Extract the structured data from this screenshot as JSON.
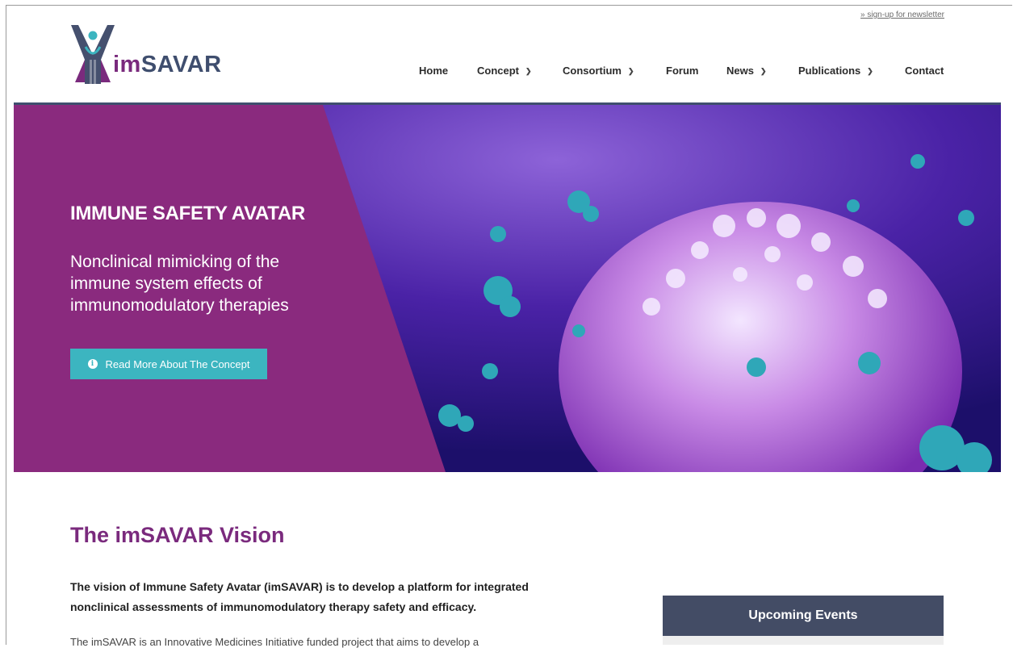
{
  "header": {
    "newsletter_link": "» sign-up for newsletter",
    "logo_text_im": "im",
    "logo_text_savar": "SAVAR"
  },
  "nav": {
    "items": [
      {
        "label": "Home",
        "has_dropdown": false
      },
      {
        "label": "Concept",
        "has_dropdown": true
      },
      {
        "label": "Consortium",
        "has_dropdown": true
      },
      {
        "label": "Forum",
        "has_dropdown": false
      },
      {
        "label": "News",
        "has_dropdown": true
      },
      {
        "label": "Publications",
        "has_dropdown": true
      },
      {
        "label": "Contact",
        "has_dropdown": false
      }
    ],
    "chevron": "⌄"
  },
  "hero": {
    "title": "IMMUNE SAFETY AVATAR",
    "subtitle": "Nonclinical mimicking of the immune system effects of immunomodulatory therapies",
    "button_label": "Read More About The Concept",
    "button_icon": "info-icon",
    "colors": {
      "panel": "#8a2a7e",
      "button": "#3cb5c0",
      "top_border": "#3f4e6e"
    }
  },
  "vision": {
    "title": "The imSAVAR Vision",
    "lead": "The vision of Immune Safety Avatar (imSAVAR) is to develop a platform for integrated nonclinical assessments of immunomodulatory therapy safety and efficacy.",
    "body_start": "The imSAVAR is an Innovative Medicines Initiative funded project that aims to develop a"
  },
  "sidebar": {
    "events_title": "Upcoming Events"
  },
  "colors": {
    "brand_purple": "#7a2a7d",
    "brand_navy": "#3f4e6e",
    "events_header": "#434c65"
  }
}
